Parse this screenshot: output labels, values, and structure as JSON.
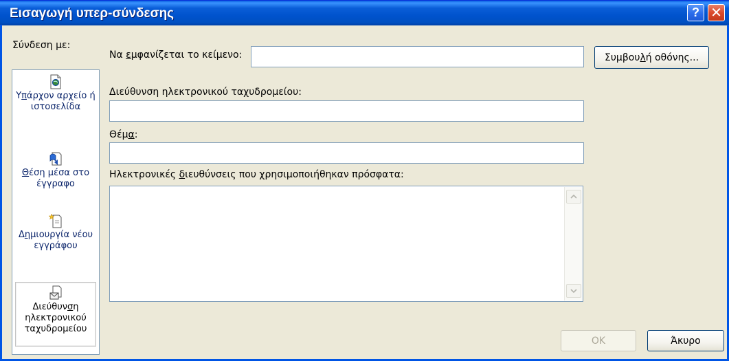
{
  "window": {
    "title": "Εισαγωγή υπερ-σύνδεσης",
    "help_glyph": "?",
    "close_glyph": "✕"
  },
  "link_to": {
    "label": "Σύνδεση με:",
    "items": [
      {
        "icon": "existing-file-icon",
        "label_pre": "Υ",
        "label_ul": "π",
        "label_post": "άρχον αρχείο ή ιστοσελίδα"
      },
      {
        "icon": "place-in-document-icon",
        "label_pre": "",
        "label_ul": "Θ",
        "label_post": "έση μέσα στο έγγραφο"
      },
      {
        "icon": "new-document-icon",
        "label_pre": "Δ",
        "label_ul": "η",
        "label_post": "μιουργία νέου εγγράφου"
      },
      {
        "icon": "email-address-icon",
        "label_pre": "Διεύθυν",
        "label_ul": "σ",
        "label_post": "η ηλεκτρονικού ταχυδρομείου",
        "selected": true
      }
    ]
  },
  "display_text": {
    "label_pre": "Να ",
    "label_ul": "ε",
    "label_post": "μφανίζεται το κείμενο:",
    "value": ""
  },
  "screentip_button": {
    "label_pre": "Συμβου",
    "label_ul": "λ",
    "label_post": "ή οθόνης..."
  },
  "email_address": {
    "label_pre": "Διεύθυνση ηλεκτρονικού τα",
    "label_ul": "χ",
    "label_post": "υδρομείου:",
    "value": ""
  },
  "subject": {
    "label_pre": "Θέμ",
    "label_ul": "α",
    "label_post": ":",
    "value": ""
  },
  "recent": {
    "label_pre": "Ηλεκτρονικές ",
    "label_ul": "δ",
    "label_post": "ιευθύνσεις που χρησιμοποιήθηκαν πρόσφατα:",
    "items": []
  },
  "buttons": {
    "ok": "OK",
    "cancel": "Άκυρο"
  }
}
